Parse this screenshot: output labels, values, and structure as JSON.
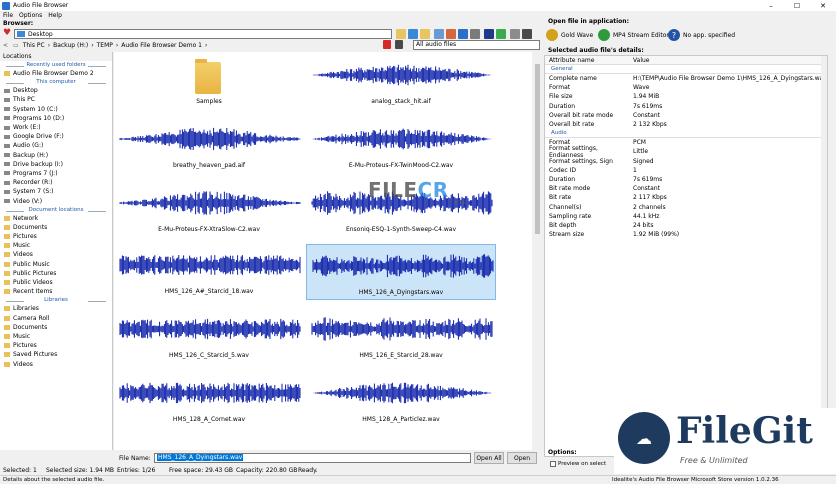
{
  "window": {
    "title": "Audio File Browser",
    "controls": [
      "–",
      "☐",
      "✕"
    ]
  },
  "menu": [
    "File",
    "Options",
    "Help"
  ],
  "browser": {
    "label": "Browser:",
    "path_value": "Desktop",
    "crumbs": [
      "This PC",
      "Backup (H:)",
      "TEMP",
      "Audio File Browser Demo 1"
    ],
    "filter_value": "All audio files"
  },
  "locations": {
    "header": "Locations",
    "recent_title": "Recently used folders",
    "recent": [
      "Audio File Browser Demo 2"
    ],
    "computer_title": "This computer",
    "computer": [
      "Desktop",
      "This PC",
      "System 10 (C:)",
      "Programs 10 (D:)",
      "Work (E:)",
      "Google Drive (F:)",
      "Audio (G:)",
      "Backup (H:)",
      "Drive backup (I:)",
      "Programs 7 (J:)",
      "Recorder (R:)",
      "System 7 (S:)",
      "Video (V:)"
    ],
    "network_title": "Document locations",
    "network": [
      "Network",
      "Documents",
      "Pictures",
      "Music",
      "Videos",
      "Public Music",
      "Public Pictures",
      "Public Videos",
      "Recent Items"
    ],
    "libraries_title": "Libraries",
    "libraries": [
      "Libraries",
      "Camera Roll",
      "Documents",
      "Music",
      "Pictures",
      "Saved Pictures",
      "Videos"
    ]
  },
  "files": [
    {
      "name": "Samples",
      "folder": true
    },
    {
      "name": "analog_stack_hit.aif"
    },
    {
      "name": "breathy_heaven_pad.aif"
    },
    {
      "name": "E-Mu-Proteus-FX-TwinMood-C2.wav"
    },
    {
      "name": "E-Mu-Proteus-FX-XtraSlow-C2.wav"
    },
    {
      "name": "Ensoniq-ESQ-1-Synth-Sweep-C4.wav"
    },
    {
      "name": "HMS_126_A#_Starcid_18.wav"
    },
    {
      "name": "HMS_126_A_Dyingstars.wav",
      "selected": true
    },
    {
      "name": "HMS_126_C_Starcid_5.wav"
    },
    {
      "name": "HMS_126_E_Starcid_28.wav"
    },
    {
      "name": "HMS_128_A_Cornet.wav"
    },
    {
      "name": "HMS_128_A_Particlez.wav"
    }
  ],
  "file_name": {
    "label": "File Name:",
    "value": "HMS_126_A_Dyingstars.wav"
  },
  "buttons": {
    "open_all": "Open All",
    "open": "Open"
  },
  "status": {
    "selected": "Selected: 1",
    "selected_size": "Selected size: 1.94 MB",
    "entries": "Entries: 1/26",
    "free_space": "Free space: 29.43 GB",
    "capacity": "Capacity: 220.80 GB",
    "state": "Ready."
  },
  "bottom": {
    "left": "Details about the selected audio file.",
    "right": "Idealite's Audio File Browser Microsoft Store version 1.0.2.36"
  },
  "open_in_app": {
    "label": "Open file in application:",
    "apps": [
      {
        "name": "Gold Wave",
        "color": "#d1a21c"
      },
      {
        "name": "MP4 Stream Editor",
        "color": "#2f9a3b"
      },
      {
        "name": "No app. specified",
        "color": "#2452a6"
      }
    ]
  },
  "details": {
    "title": "Selected audio file's details:",
    "col_attr": "Attribute name",
    "col_val": "Value",
    "general_title": "General",
    "general": [
      {
        "k": "Complete name",
        "v": "H:\\TEMP\\Audio File Browser Demo 1\\HMS_126_A_Dyingstars.wav"
      },
      {
        "k": "Format",
        "v": "Wave"
      },
      {
        "k": "File size",
        "v": "1.94 MiB"
      },
      {
        "k": "Duration",
        "v": "7s 619ms"
      },
      {
        "k": "Overall bit rate mode",
        "v": "Constant"
      },
      {
        "k": "Overall bit rate",
        "v": "2 132 Kbps"
      }
    ],
    "audio_title": "Audio",
    "audio": [
      {
        "k": "Format",
        "v": "PCM"
      },
      {
        "k": "Format settings, Endianness",
        "v": "Little"
      },
      {
        "k": "Format settings, Sign",
        "v": "Signed"
      },
      {
        "k": "Codec ID",
        "v": "1"
      },
      {
        "k": "Duration",
        "v": "7s 619ms"
      },
      {
        "k": "Bit rate mode",
        "v": "Constant"
      },
      {
        "k": "Bit rate",
        "v": "2 117 Kbps"
      },
      {
        "k": "Channel(s)",
        "v": "2 channels"
      },
      {
        "k": "Sampling rate",
        "v": "44.1 kHz"
      },
      {
        "k": "Bit depth",
        "v": "24 bits"
      },
      {
        "k": "Stream size",
        "v": "1.92 MiB (99%)"
      }
    ]
  },
  "options": {
    "label": "Options:",
    "preview": "Preview on select"
  },
  "watermark": {
    "text_a": "FILE",
    "text_b": "CR",
    "sub": ".com"
  },
  "filegit": {
    "title": "FileGit",
    "tagline": "Free & Unlimited"
  },
  "colors": {
    "wave": "#0b1ea8",
    "selection": "#cce4f7",
    "link": "#1e5aa8"
  }
}
